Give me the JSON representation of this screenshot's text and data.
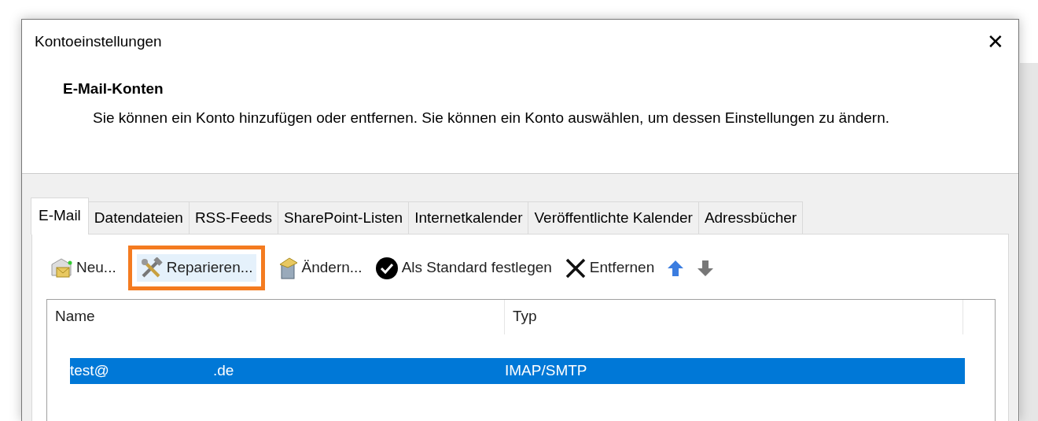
{
  "window": {
    "title": "Kontoeinstellungen",
    "close": "✕"
  },
  "header": {
    "title": "E-Mail-Konten",
    "description": "Sie können ein Konto hinzufügen oder entfernen. Sie können ein Konto auswählen, um dessen Einstellungen zu ändern."
  },
  "tabs": [
    {
      "label": "E-Mail",
      "selected": true
    },
    {
      "label": "Datendateien",
      "selected": false
    },
    {
      "label": "RSS-Feeds",
      "selected": false
    },
    {
      "label": "SharePoint-Listen",
      "selected": false
    },
    {
      "label": "Internetkalender",
      "selected": false
    },
    {
      "label": "Veröffentlichte Kalender",
      "selected": false
    },
    {
      "label": "Adressbücher",
      "selected": false
    }
  ],
  "toolbar": [
    {
      "kind": "new",
      "label": "Neu...",
      "highlighted": false
    },
    {
      "kind": "repair",
      "label": "Reparieren...",
      "highlighted": true
    },
    {
      "kind": "change",
      "label": "Ändern...",
      "highlighted": false
    },
    {
      "kind": "default",
      "label": "Als Standard festlegen",
      "highlighted": false
    },
    {
      "kind": "remove",
      "label": "Entfernen",
      "highlighted": false
    },
    {
      "kind": "up",
      "highlighted": false
    },
    {
      "kind": "down",
      "highlighted": false
    }
  ],
  "table": {
    "columns": [
      "Name",
      "Typ"
    ],
    "rows": [
      {
        "name_start": "test@",
        "name_end": ".de",
        "type": "IMAP/SMTP",
        "selected": true
      }
    ]
  }
}
